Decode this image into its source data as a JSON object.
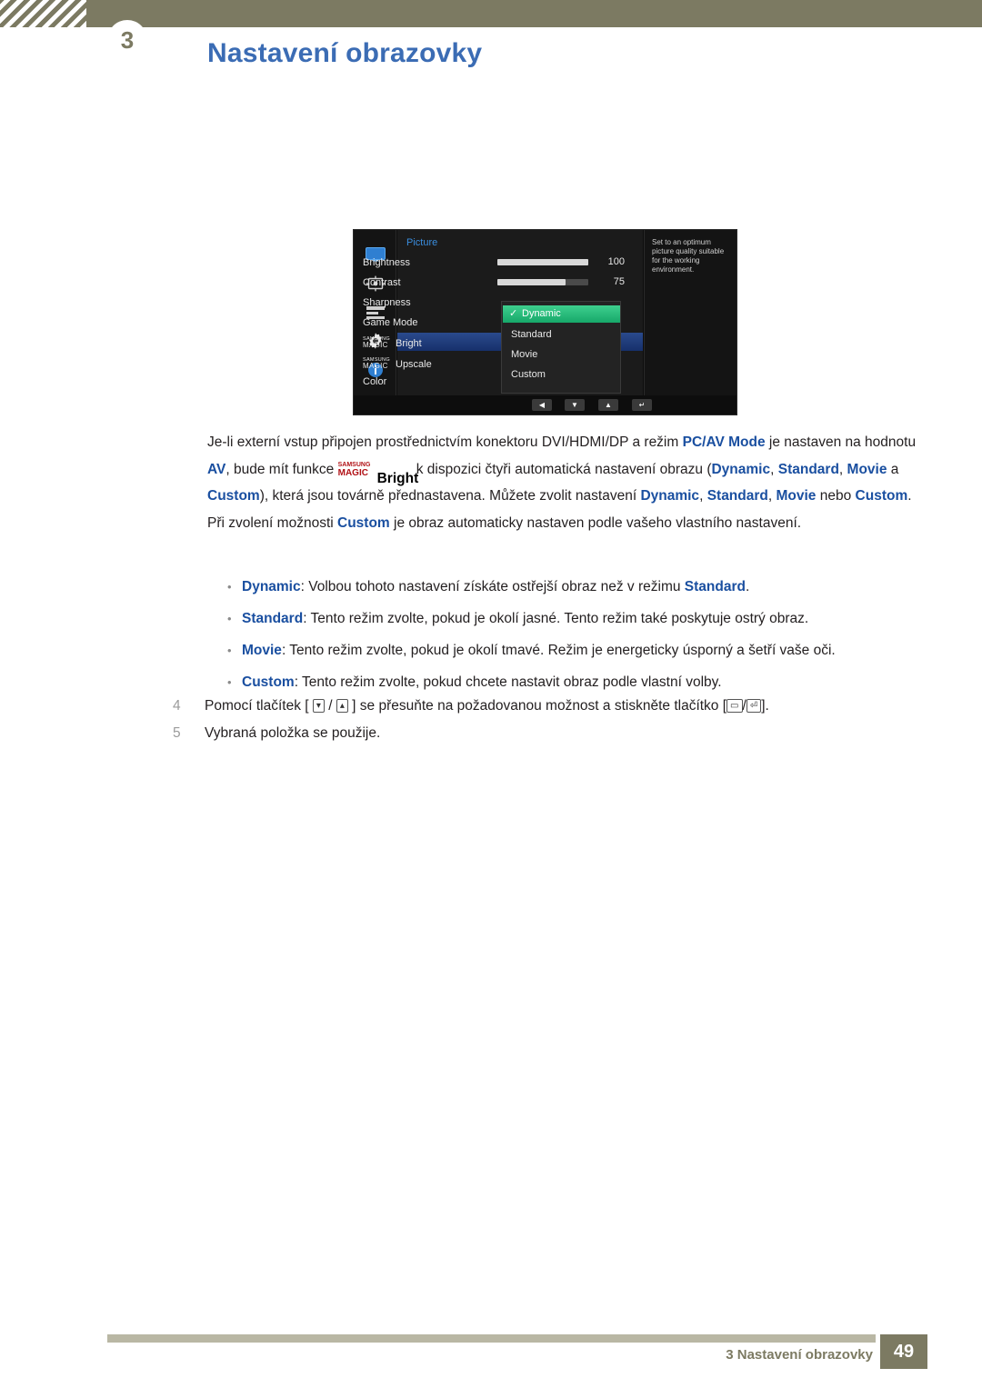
{
  "header": {
    "chapter_number": "3",
    "title": "Nastavení obrazovky"
  },
  "osd": {
    "category": "Picture",
    "menu_items": [
      "Brightness",
      "Contrast",
      "Sharpness",
      "Game Mode",
      "Color"
    ],
    "magic_rows": [
      {
        "small": "SAMSUNG",
        "big": "MAGIC",
        "suffix": "Bright"
      },
      {
        "small": "SAMSUNG",
        "big": "MAGIC",
        "suffix": "Upscale"
      }
    ],
    "values": {
      "brightness": "100",
      "contrast": "75"
    },
    "submenu": {
      "items": [
        "Dynamic",
        "Standard",
        "Movie",
        "Custom"
      ],
      "selected": "Dynamic",
      "check_glyph": "✓"
    },
    "help_text": "Set to an optimum picture quality suitable for the working environment.",
    "footer_buttons": [
      "◀",
      "▼",
      "▲",
      "↵"
    ],
    "icons": [
      "monitor-icon",
      "screen-adjust-icon",
      "osd-menu-icon",
      "settings-gear-icon",
      "information-icon"
    ],
    "colors": {
      "accent_blue": "#3a8dde",
      "highlight_green": "#2bbd7e",
      "highlight_blue": "#2a4a8c"
    }
  },
  "body": {
    "paragraph": {
      "seg1": "Je-li externí vstup připojen prostřednictvím konektoru DVI/HDMI/DP a režim ",
      "pcav": "PC/AV Mode",
      "seg2": " je nastaven na hodnotu ",
      "av": "AV",
      "seg3": ", bude mít funkce ",
      "magic_small": "SAMSUNG",
      "magic_big": "MAGIC",
      "magic_suffix": "Bright",
      "seg4": " k dispozici čtyři automatická nastavení obrazu (",
      "m1": "Dynamic",
      "sep1": ", ",
      "m2": "Standard",
      "sep2": ", ",
      "m3": "Movie",
      "sep3": " a ",
      "m4": "Custom",
      "seg5": "), která jsou továrně přednastavena. Můžete zvolit nastavení ",
      "n1": "Dynamic",
      "nsep1": ", ",
      "n2": "Standard",
      "nsep2": ", ",
      "n3": "Movie",
      "nsep3": " nebo ",
      "n4": "Custom",
      "seg6": ". Při zvolení možnosti ",
      "n5": "Custom",
      "seg7": " je obraz automaticky nastaven podle vašeho vlastního nastavení."
    },
    "bullets": [
      {
        "term": "Dynamic",
        "text": ": Volbou tohoto nastavení získáte ostřejší obraz než v režimu ",
        "tail_term": "Standard",
        "tail": "."
      },
      {
        "term": "Standard",
        "text": ": Tento režim zvolte, pokud je okolí jasné. Tento režim také poskytuje ostrý obraz.",
        "tail_term": "",
        "tail": ""
      },
      {
        "term": "Movie",
        "text": ": Tento režim zvolte, pokud je okolí tmavé. Režim je energeticky úsporný a šetří vaše oči.",
        "tail_term": "",
        "tail": ""
      },
      {
        "term": "Custom",
        "text": ": Tento režim zvolte, pokud chcete nastavit obraz podle vlastní volby.",
        "tail_term": "",
        "tail": ""
      }
    ],
    "steps": [
      {
        "num": "4",
        "pre": "Pomocí tlačítek [ ",
        "k1": "▾",
        "mid1": " / ",
        "k2": "▴",
        "mid2": " ] se přesuňte na požadovanou možnost a stiskněte tlačítko [",
        "k3": "▭",
        "mid3": "/",
        "k4": "⏎",
        "post": "]."
      },
      {
        "num": "5",
        "pre": "Vybraná položka se použije.",
        "k1": "",
        "mid1": "",
        "k2": "",
        "mid2": "",
        "k3": "",
        "mid3": "",
        "k4": "",
        "post": ""
      }
    ]
  },
  "footer": {
    "text": "3 Nastavení obrazovky",
    "page": "49"
  }
}
